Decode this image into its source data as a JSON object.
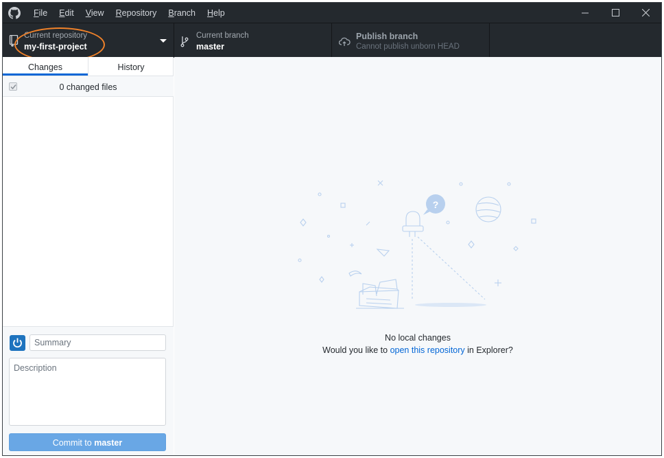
{
  "titlebar": {
    "menu": [
      {
        "first": "F",
        "rest": "ile"
      },
      {
        "first": "E",
        "rest": "dit"
      },
      {
        "first": "V",
        "rest": "iew"
      },
      {
        "first": "R",
        "rest": "epository"
      },
      {
        "first": "B",
        "rest": "ranch"
      },
      {
        "first": "H",
        "rest": "elp"
      }
    ]
  },
  "toolbar": {
    "repo_label": "Current repository",
    "repo_value": "my-first-project",
    "branch_label": "Current branch",
    "branch_value": "master",
    "publish_label": "Publish branch",
    "publish_sub": "Cannot publish unborn HEAD"
  },
  "sidebar": {
    "tabs": [
      "Changes",
      "History"
    ],
    "changed_files": "0 changed files",
    "summary_placeholder": "Summary",
    "description_placeholder": "Description",
    "commit_prefix": "Commit to ",
    "commit_branch": "master"
  },
  "main": {
    "empty_title": "No local changes",
    "empty_prefix": "Would you like to ",
    "empty_link": "open this repository",
    "empty_suffix": " in Explorer?"
  },
  "colors": {
    "titlebar_bg": "#24292e",
    "accent": "#0366d6",
    "commit_button": "#69a7e5",
    "annotation": "#f0822a"
  }
}
